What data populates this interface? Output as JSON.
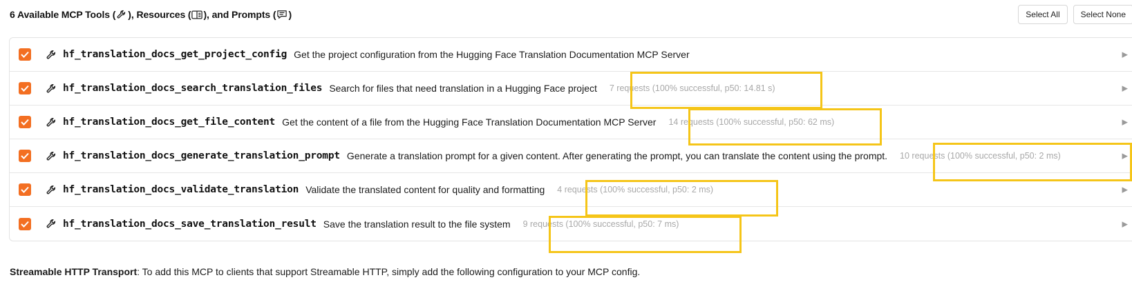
{
  "header": {
    "title_part1": "6 Available MCP Tools (",
    "title_part2": "), Resources (",
    "title_part3": "), and Prompts (",
    "title_part4": ")",
    "tool_icon": "wrench-icon",
    "resource_icon": "book-icon",
    "prompt_icon": "chat-icon",
    "select_all_label": "Select All",
    "select_none_label": "Select None"
  },
  "colors": {
    "checkbox": "#f36f22",
    "highlight": "#f5c518",
    "stats_text": "#a8a8a8"
  },
  "tools": [
    {
      "name": "hf_translation_docs_get_project_config",
      "description": "Get the project configuration from the Hugging Face Translation Documentation MCP Server",
      "stats": "",
      "checked": true,
      "expand_icon": "triangle-right-icon"
    },
    {
      "name": "hf_translation_docs_search_translation_files",
      "description": "Search for files that need translation in a Hugging Face project",
      "stats": "7 requests (100% successful, p50: 14.81 s)",
      "checked": true,
      "expand_icon": "triangle-right-icon"
    },
    {
      "name": "hf_translation_docs_get_file_content",
      "description": "Get the content of a file from the Hugging Face Translation Documentation MCP Server",
      "stats": "14 requests (100% successful, p50: 62 ms)",
      "checked": true,
      "expand_icon": "triangle-right-icon"
    },
    {
      "name": "hf_translation_docs_generate_translation_prompt",
      "description": "Generate a translation prompt for a given content. After generating the prompt, you can translate the content using the prompt.",
      "stats": "10 requests (100% successful, p50: 2 ms)",
      "checked": true,
      "expand_icon": "triangle-right-icon"
    },
    {
      "name": "hf_translation_docs_validate_translation",
      "description": "Validate the translated content for quality and formatting",
      "stats": "4 requests (100% successful, p50: 2 ms)",
      "checked": true,
      "expand_icon": "triangle-right-icon"
    },
    {
      "name": "hf_translation_docs_save_translation_result",
      "description": "Save the translation result to the file system",
      "stats": "9 requests (100% successful, p50: 7 ms)",
      "checked": true,
      "expand_icon": "triangle-right-icon"
    }
  ],
  "footer": {
    "bold": "Streamable HTTP Transport",
    "text": ": To add this MCP to clients that support Streamable HTTP, simply add the following configuration to your MCP config."
  }
}
